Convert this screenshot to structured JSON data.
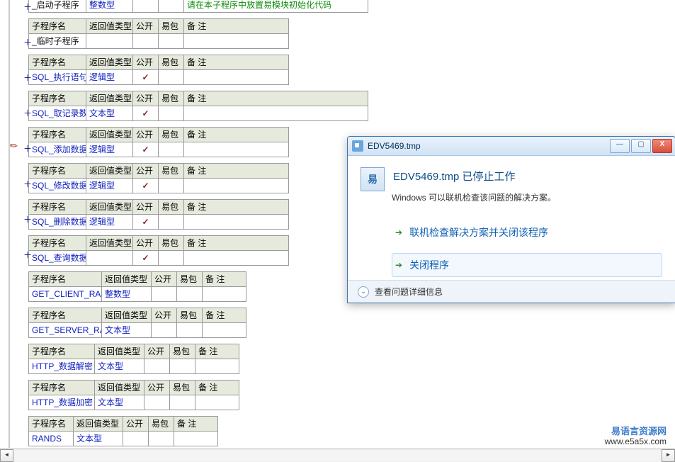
{
  "headers": {
    "sub_name": "子程序名",
    "return_type": "返回值类型",
    "public": "公开",
    "easy_pkg": "易包",
    "note": "备 注"
  },
  "checkmark": "✓",
  "plus": "＋",
  "top_row": {
    "name": "_启动子程序",
    "type": "整数型",
    "note": "请在本子程序中放置易模块初始化代码"
  },
  "subs": [
    {
      "name": "_临时子程序",
      "type": "",
      "public": false,
      "variant": "wide"
    },
    {
      "name": "SQL_执行语句",
      "type": "逻辑型",
      "public": true,
      "variant": "wide"
    },
    {
      "name": "SQL_取记录数",
      "type": "文本型",
      "public": true,
      "variant": "wide",
      "note_long": true
    },
    {
      "name": "SQL_添加数据",
      "type": "逻辑型",
      "public": true,
      "variant": "wide"
    },
    {
      "name": "SQL_修改数据",
      "type": "逻辑型",
      "public": true,
      "variant": "wide"
    },
    {
      "name": "SQL_删除数据",
      "type": "逻辑型",
      "public": true,
      "variant": "wide"
    },
    {
      "name": "SQL_查询数据",
      "type": "",
      "public": true,
      "variant": "wide"
    },
    {
      "name": "GET_CLIENT_RAND",
      "type": "整数型",
      "public": false,
      "variant": "narrow"
    },
    {
      "name": "GET_SERVER_RAND",
      "type": "文本型",
      "public": false,
      "variant": "narrow"
    },
    {
      "name": "HTTP_数据解密",
      "type": "文本型",
      "public": false,
      "variant": "narrow"
    },
    {
      "name": "HTTP_数据加密",
      "type": "文本型",
      "public": false,
      "variant": "narrow"
    },
    {
      "name": "RANDS",
      "type": "文本型",
      "public": false,
      "variant": "narrow2"
    }
  ],
  "dialog": {
    "title": "EDV5469.tmp",
    "heading": "EDV5469.tmp 已停止工作",
    "sub": "Windows 可以联机检查该问题的解决方案。",
    "link1": "联机检查解决方案并关闭该程序",
    "link2": "关闭程序",
    "footer": "查看问题详细信息",
    "min": "—",
    "max": "▢",
    "close": "X",
    "chev": "⌄"
  },
  "watermark": {
    "line1": "易语言资源网",
    "line2": "www.e5a5x.com"
  },
  "scroll": {
    "left": "◄",
    "right": "►"
  }
}
